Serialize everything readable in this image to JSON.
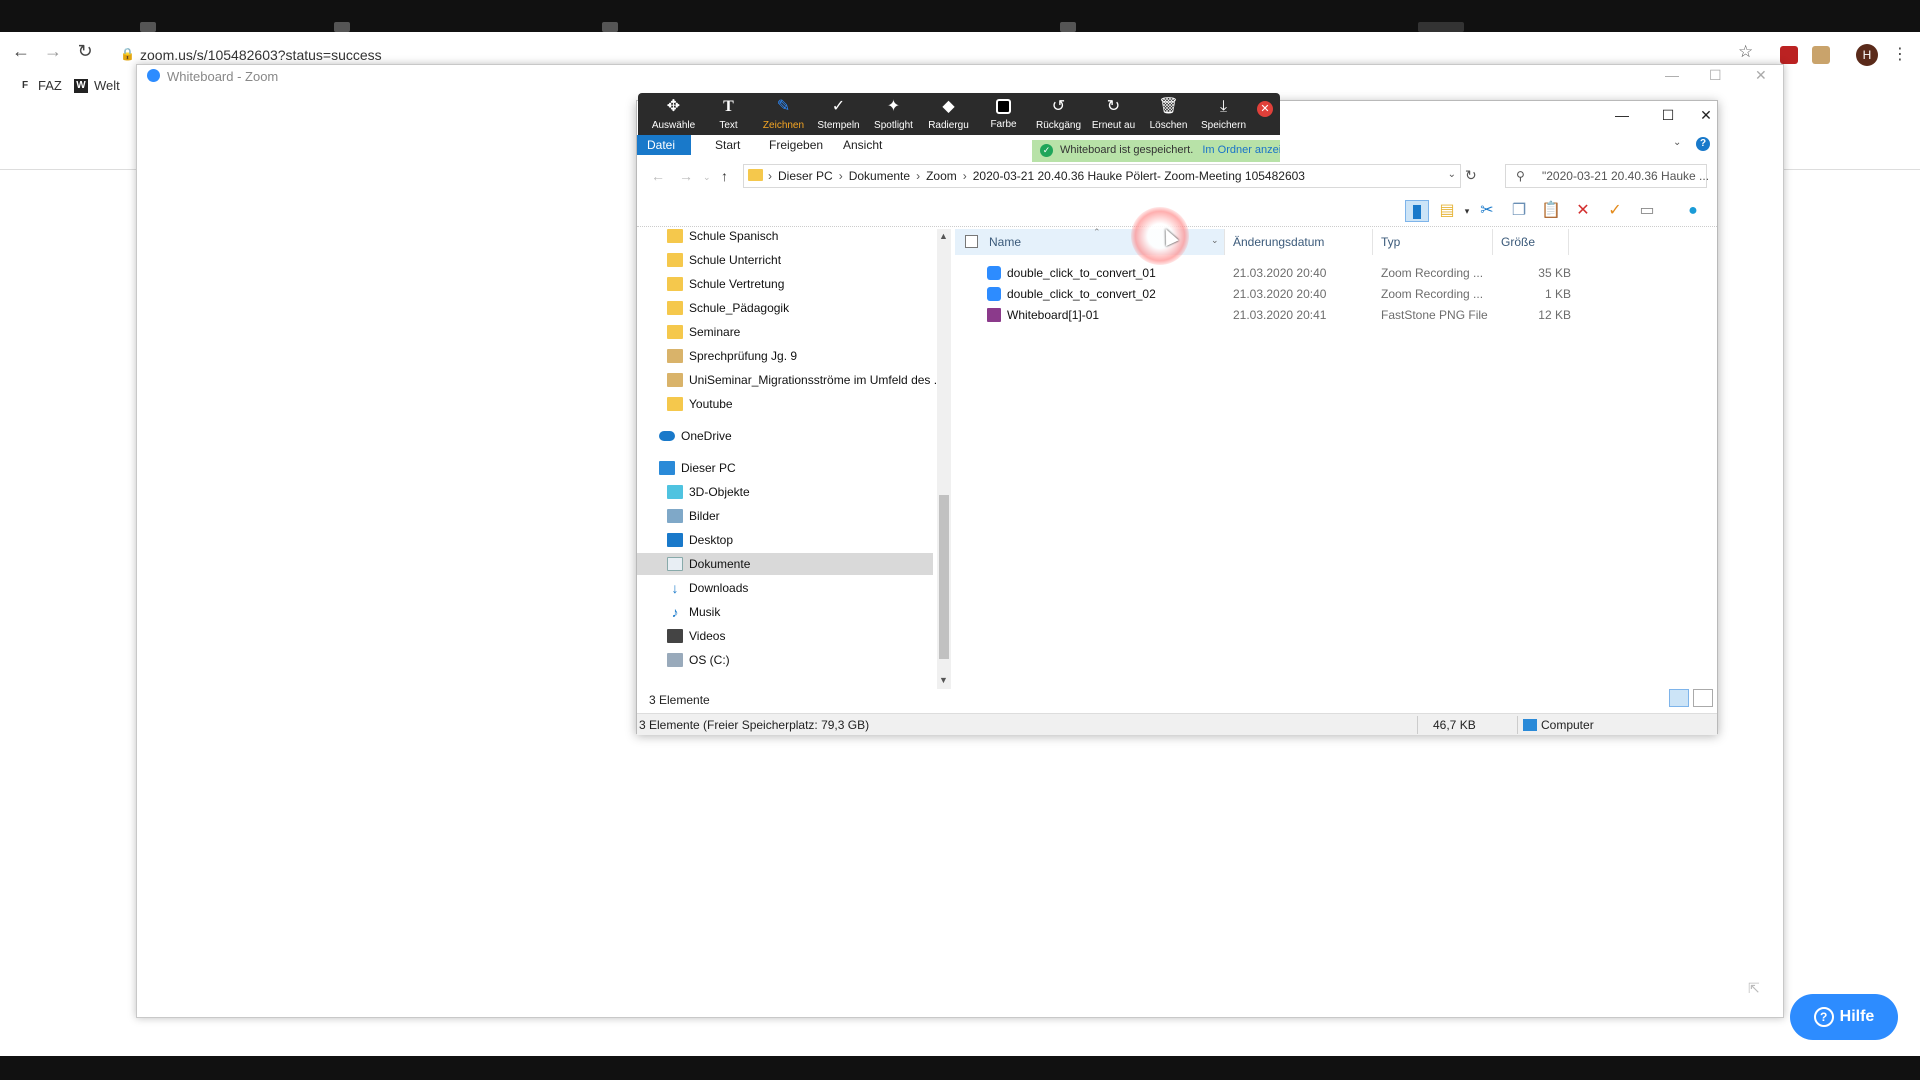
{
  "browser": {
    "url": "zoom.us/s/105482603?status=success",
    "profile_initial": "H",
    "bookmarks": [
      {
        "label": "FAZ",
        "icon": "faz-icon"
      },
      {
        "label": "Welt",
        "icon": "welt-icon"
      }
    ]
  },
  "zoom_window": {
    "title": "Whiteboard - Zoom"
  },
  "whiteboard_toolbar": {
    "tools": [
      {
        "label": "Auswähle",
        "icon": "move-icon",
        "active": false
      },
      {
        "label": "Text",
        "icon": "text-icon",
        "active": false
      },
      {
        "label": "Zeichnen",
        "icon": "pen-icon",
        "active": true
      },
      {
        "label": "Stempeln",
        "icon": "checkmark-icon",
        "active": false
      },
      {
        "label": "Spotlight",
        "icon": "spotlight-icon",
        "active": false
      },
      {
        "label": "Radiergu",
        "icon": "eraser-icon",
        "active": false
      },
      {
        "label": "Farbe",
        "icon": "color-icon",
        "active": false
      },
      {
        "label": "Rückgäng",
        "icon": "undo-icon",
        "active": false
      },
      {
        "label": "Erneut au",
        "icon": "redo-icon",
        "active": false
      },
      {
        "label": "Löschen",
        "icon": "trash-icon",
        "active": false
      },
      {
        "label": "Speichern",
        "icon": "save-icon",
        "active": false
      }
    ]
  },
  "toast": {
    "message": "Whiteboard ist gespeichert.",
    "link": "Im Ordner anzeigen"
  },
  "explorer": {
    "ribbon_tabs": [
      "Datei",
      "Start",
      "Freigeben",
      "Ansicht"
    ],
    "breadcrumb": [
      "Dieser PC",
      "Dokumente",
      "Zoom",
      "2020-03-21 20.40.36 Hauke Pölert- Zoom-Meeting  105482603"
    ],
    "search_text": "\"2020-03-21 20.40.36 Hauke ...",
    "nav_items": [
      {
        "label": "Schule Spanisch",
        "icon": "folder-icon",
        "indent": 1
      },
      {
        "label": "Schule Unterricht",
        "icon": "folder-icon",
        "indent": 1
      },
      {
        "label": "Schule Vertretung",
        "icon": "folder-icon",
        "indent": 1
      },
      {
        "label": "Schule_Pädagogik",
        "icon": "folder-icon",
        "indent": 1
      },
      {
        "label": "Seminare",
        "icon": "folder-icon",
        "indent": 1
      },
      {
        "label": "Sprechprüfung Jg. 9",
        "icon": "folder-icon",
        "indent": 1
      },
      {
        "label": "UniSeminar_Migrationsströme im Umfeld des ...",
        "icon": "folder-icon",
        "indent": 1
      },
      {
        "label": "Youtube",
        "icon": "folder-icon",
        "indent": 1
      },
      {
        "label": "OneDrive",
        "icon": "cloud-icon",
        "indent": 0
      },
      {
        "label": "Dieser PC",
        "icon": "computer-icon",
        "indent": 0
      },
      {
        "label": "3D-Objekte",
        "icon": "cube-icon",
        "indent": 1
      },
      {
        "label": "Bilder",
        "icon": "pictures-icon",
        "indent": 1
      },
      {
        "label": "Desktop",
        "icon": "desktop-icon",
        "indent": 1
      },
      {
        "label": "Dokumente",
        "icon": "documents-icon",
        "indent": 1,
        "selected": true
      },
      {
        "label": "Downloads",
        "icon": "download-icon",
        "indent": 1
      },
      {
        "label": "Musik",
        "icon": "music-icon",
        "indent": 1
      },
      {
        "label": "Videos",
        "icon": "video-icon",
        "indent": 1
      },
      {
        "label": "OS (C:)",
        "icon": "drive-icon",
        "indent": 1
      }
    ],
    "columns": {
      "name": "Name",
      "date": "Änderungsdatum",
      "type": "Typ",
      "size": "Größe"
    },
    "files": [
      {
        "name": "double_click_to_convert_01",
        "date": "21.03.2020 20:40",
        "type": "Zoom Recording ...",
        "size": "35 KB",
        "icon": "zoom-file-icon"
      },
      {
        "name": "double_click_to_convert_02",
        "date": "21.03.2020 20:40",
        "type": "Zoom Recording ...",
        "size": "1 KB",
        "icon": "zoom-file-icon"
      },
      {
        "name": "Whiteboard[1]-01",
        "date": "21.03.2020 20:41",
        "type": "FastStone PNG File",
        "size": "12 KB",
        "icon": "png-file-icon"
      }
    ],
    "item_count": "3 Elemente",
    "status_left": "3 Elemente (Freier Speicherplatz: 79,3 GB)",
    "status_size": "46,7 KB",
    "status_location": "Computer"
  },
  "help_button": "Hilfe"
}
